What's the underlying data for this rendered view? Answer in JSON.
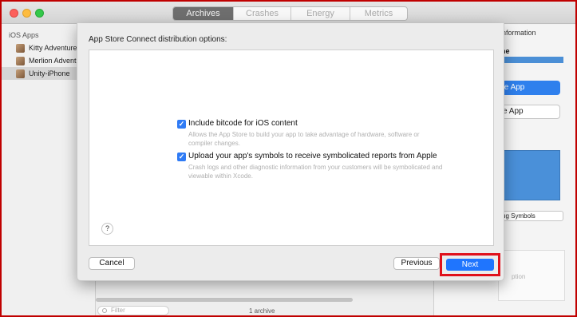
{
  "window": {
    "tabs": [
      {
        "label": "Archives",
        "active": true
      },
      {
        "label": "Crashes",
        "active": false
      },
      {
        "label": "Energy",
        "active": false
      },
      {
        "label": "Metrics",
        "active": false
      }
    ]
  },
  "sidebar": {
    "header": "iOS Apps",
    "items": [
      {
        "label": "Kitty Adventure",
        "selected": false,
        "icon": "app-icon"
      },
      {
        "label": "Merlion Adventure",
        "selected": false,
        "icon": "app-icon"
      },
      {
        "label": "Unity-iPhone",
        "selected": true,
        "icon": "app-icon"
      }
    ]
  },
  "right_pane": {
    "section_label": "nformation",
    "name_label": "ne",
    "primary_button": "te App",
    "secondary_button": "e App",
    "debug_symbols_button": "ug Symbols",
    "box_text": "ption"
  },
  "bottom": {
    "filter_placeholder": "Filter",
    "archive_count": "1 archive"
  },
  "sheet": {
    "title": "App Store Connect distribution options:",
    "options": [
      {
        "label": "Include bitcode for iOS content",
        "description": "Allows the App Store to build your app to take advantage of hardware, software or compiler changes.",
        "checked": true
      },
      {
        "label": "Upload your app's symbols to receive symbolicated reports from Apple",
        "description": "Crash logs and other diagnostic information from your customers will be symbolicated and viewable within Xcode.",
        "checked": true
      }
    ],
    "help_label": "?",
    "cancel_label": "Cancel",
    "previous_label": "Previous",
    "next_label": "Next"
  },
  "colors": {
    "accent": "#1f75fe",
    "highlight_outline": "#e0101b",
    "frame": "#c00000"
  }
}
